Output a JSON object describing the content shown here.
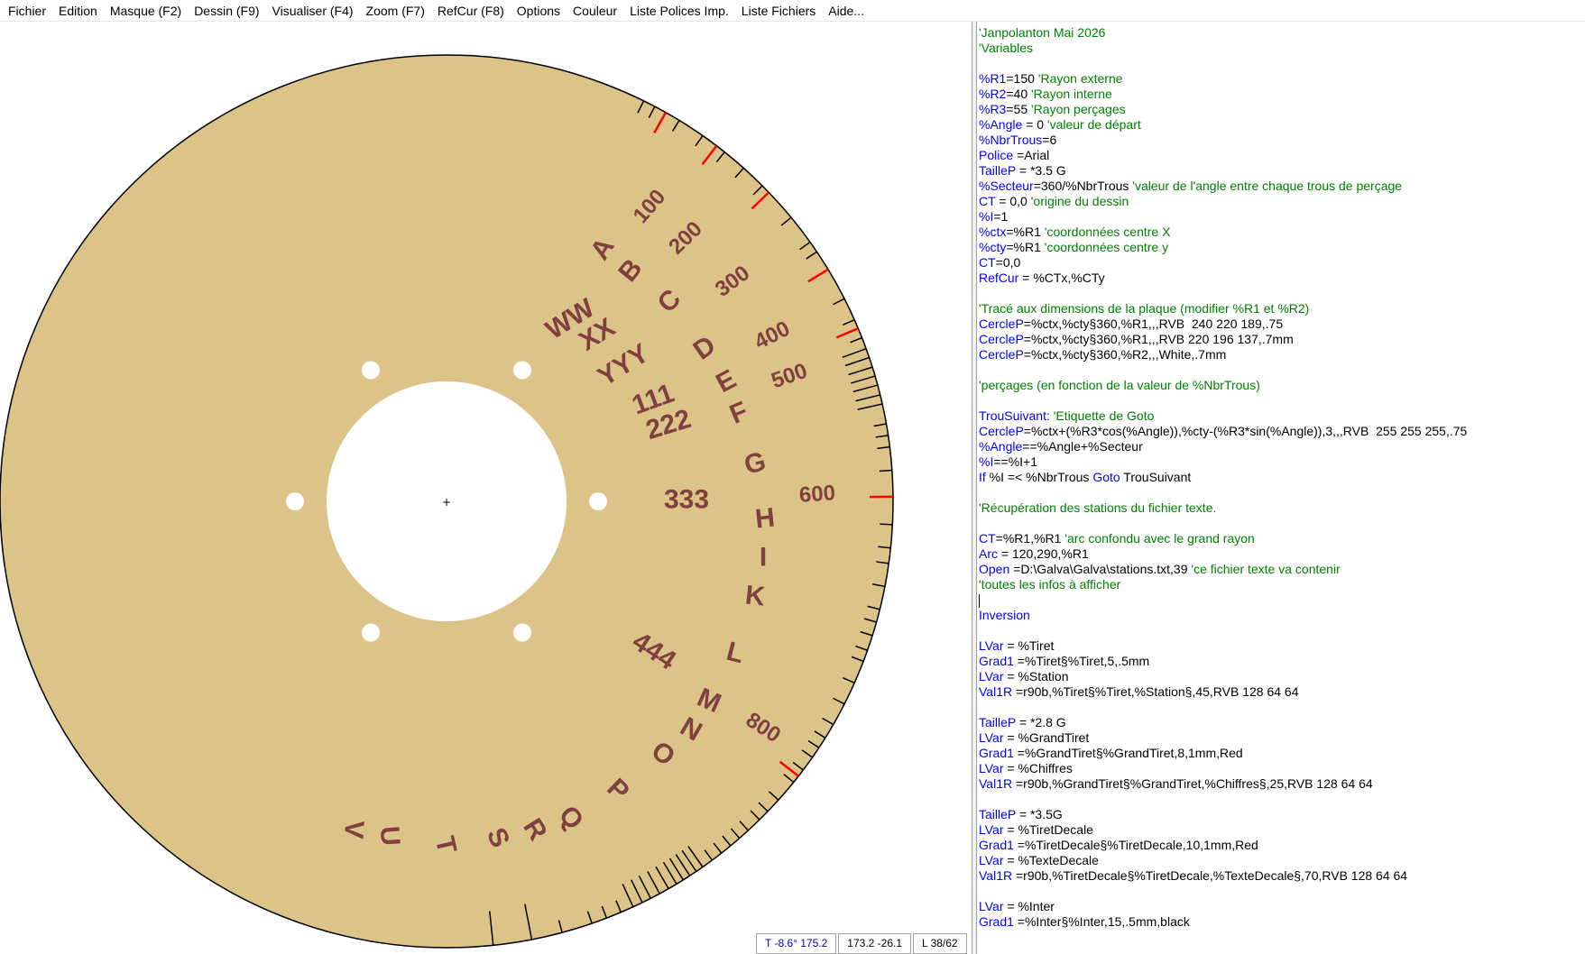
{
  "menu": [
    {
      "id": "fichier",
      "label": "Fichier"
    },
    {
      "id": "edition",
      "label": "Edition"
    },
    {
      "id": "masque",
      "label": "Masque (F2)"
    },
    {
      "id": "dessin",
      "label": "Dessin (F9)"
    },
    {
      "id": "visualiser",
      "label": "Visualiser (F4)"
    },
    {
      "id": "zoom",
      "label": "Zoom (F7)"
    },
    {
      "id": "refcur",
      "label": "RefCur (F8)"
    },
    {
      "id": "options",
      "label": "Options"
    },
    {
      "id": "couleur",
      "label": "Couleur"
    },
    {
      "id": "liste-polices",
      "label": "Liste Polices Imp."
    },
    {
      "id": "liste-fichiers",
      "label": "Liste Fichiers"
    },
    {
      "id": "aide",
      "label": "Aide..."
    }
  ],
  "colors": {
    "plate_fill": "#DCC489",
    "plate_border": "#000000",
    "label_text": "#804040",
    "tick": "#000000",
    "tick_accent": "#ff0000",
    "holes": "#ffffff",
    "code_keyword": "#0000ff",
    "code_comment": "#008000",
    "code_text": "#000000"
  },
  "drawing": {
    "letters": [
      "A",
      "B",
      "C",
      "D",
      "E",
      "F",
      "G",
      "H",
      "I",
      "K",
      "L",
      "M",
      "N",
      "O",
      "P",
      "Q",
      "R",
      "S",
      "T",
      "U",
      "V"
    ],
    "inner_labels": [
      "WW",
      "XX",
      "YYY",
      "111",
      "222",
      "333",
      "444"
    ],
    "scale_numbers": [
      "100",
      "200",
      "300",
      "400",
      "500",
      "600",
      "800"
    ],
    "center_mark": "+"
  },
  "editor": {
    "lines": [
      [
        {
          "k": "cm",
          "t": "'Janpolanton Mai 2026"
        }
      ],
      [
        {
          "k": "cm",
          "t": "'Variables"
        }
      ],
      [],
      [
        {
          "k": "kw",
          "t": "%R1"
        },
        {
          "k": "tx",
          "t": "=150 "
        },
        {
          "k": "cm",
          "t": "'Rayon externe"
        }
      ],
      [
        {
          "k": "kw",
          "t": "%R2"
        },
        {
          "k": "tx",
          "t": "=40 "
        },
        {
          "k": "cm",
          "t": "'Rayon interne"
        }
      ],
      [
        {
          "k": "kw",
          "t": "%R3"
        },
        {
          "k": "tx",
          "t": "=55 "
        },
        {
          "k": "cm",
          "t": "'Rayon perçages"
        }
      ],
      [
        {
          "k": "kw",
          "t": "%Angle"
        },
        {
          "k": "tx",
          "t": " = 0 "
        },
        {
          "k": "cm",
          "t": "'valeur de départ"
        }
      ],
      [
        {
          "k": "kw",
          "t": "%NbrTrous"
        },
        {
          "k": "tx",
          "t": "=6"
        }
      ],
      [
        {
          "k": "kw",
          "t": "Police"
        },
        {
          "k": "tx",
          "t": " =Arial"
        }
      ],
      [
        {
          "k": "kw",
          "t": "TailleP"
        },
        {
          "k": "tx",
          "t": " = *3.5 G"
        }
      ],
      [
        {
          "k": "kw",
          "t": "%Secteur"
        },
        {
          "k": "tx",
          "t": "=360/%NbrTrous "
        },
        {
          "k": "cm",
          "t": "'valeur de l'angle entre chaque trous de perçage"
        }
      ],
      [
        {
          "k": "kw",
          "t": "CT"
        },
        {
          "k": "tx",
          "t": " = 0,0 "
        },
        {
          "k": "cm",
          "t": "'origine du dessin"
        }
      ],
      [
        {
          "k": "kw",
          "t": "%I"
        },
        {
          "k": "tx",
          "t": "=1"
        }
      ],
      [
        {
          "k": "kw",
          "t": "%ctx"
        },
        {
          "k": "tx",
          "t": "=%R1 "
        },
        {
          "k": "cm",
          "t": "'coordonnées centre X"
        }
      ],
      [
        {
          "k": "kw",
          "t": "%cty"
        },
        {
          "k": "tx",
          "t": "=%R1 "
        },
        {
          "k": "cm",
          "t": "'coordonnées centre y"
        }
      ],
      [
        {
          "k": "kw",
          "t": "CT"
        },
        {
          "k": "tx",
          "t": "=0,0"
        }
      ],
      [
        {
          "k": "kw",
          "t": "RefCur"
        },
        {
          "k": "tx",
          "t": " = %CTx,%CTy"
        }
      ],
      [],
      [
        {
          "k": "cm",
          "t": "'Tracé aux dimensions de la plaque (modifier %R1 et %R2)"
        }
      ],
      [
        {
          "k": "kw",
          "t": "CercleP"
        },
        {
          "k": "tx",
          "t": "=%ctx,%cty§360,%R1,,,RVB  240 220 189,.75"
        }
      ],
      [
        {
          "k": "kw",
          "t": "CercleP"
        },
        {
          "k": "tx",
          "t": "=%ctx,%cty§360,%R1,,,RVB 220 196 137,.7mm"
        }
      ],
      [
        {
          "k": "kw",
          "t": "CercleP"
        },
        {
          "k": "tx",
          "t": "=%ctx,%cty§360,%R2,,,White,.7mm"
        }
      ],
      [],
      [
        {
          "k": "cm",
          "t": "'perçages (en fonction de la valeur de %NbrTrous)"
        }
      ],
      [],
      [
        {
          "k": "kw",
          "t": "TrouSuivant:"
        },
        {
          "k": "tx",
          "t": " "
        },
        {
          "k": "cm",
          "t": "'Etiquette de Goto"
        }
      ],
      [
        {
          "k": "kw",
          "t": "CercleP"
        },
        {
          "k": "tx",
          "t": "=%ctx+(%R3*cos(%Angle)),%cty-(%R3*sin(%Angle)),3,,,RVB  255 255 255,.75"
        }
      ],
      [
        {
          "k": "kw",
          "t": "%Angle"
        },
        {
          "k": "tx",
          "t": "==%Angle+%Secteur"
        }
      ],
      [
        {
          "k": "kw",
          "t": "%I"
        },
        {
          "k": "tx",
          "t": "==%I+1"
        }
      ],
      [
        {
          "k": "kw",
          "t": "If"
        },
        {
          "k": "tx",
          "t": " %I =< %NbrTrous "
        },
        {
          "k": "kw",
          "t": "Goto"
        },
        {
          "k": "tx",
          "t": " TrouSuivant"
        }
      ],
      [],
      [
        {
          "k": "cm",
          "t": "'Récupération des stations du fichier texte."
        }
      ],
      [],
      [
        {
          "k": "kw",
          "t": "CT"
        },
        {
          "k": "tx",
          "t": "=%R1,%R1 "
        },
        {
          "k": "cm",
          "t": "'arc confondu avec le grand rayon"
        }
      ],
      [
        {
          "k": "kw",
          "t": "Arc"
        },
        {
          "k": "tx",
          "t": " = 120,290,%R1"
        }
      ],
      [
        {
          "k": "kw",
          "t": "Open"
        },
        {
          "k": "tx",
          "t": " =D:\\Galva\\Galva\\stations.txt,39 "
        },
        {
          "k": "cm",
          "t": "'ce fichier texte va contenir"
        }
      ],
      [
        {
          "k": "cm",
          "t": "'toutes les infos à afficher"
        }
      ],
      [
        {
          "k": "caret",
          "t": ""
        }
      ],
      [
        {
          "k": "kw",
          "t": "Inversion"
        }
      ],
      [],
      [
        {
          "k": "kw",
          "t": "LVar"
        },
        {
          "k": "tx",
          "t": " = %Tiret"
        }
      ],
      [
        {
          "k": "kw",
          "t": "Grad1"
        },
        {
          "k": "tx",
          "t": " =%Tiret§%Tiret,5,.5mm"
        }
      ],
      [
        {
          "k": "kw",
          "t": "LVar"
        },
        {
          "k": "tx",
          "t": " = %Station"
        }
      ],
      [
        {
          "k": "kw",
          "t": "Val1R"
        },
        {
          "k": "tx",
          "t": " =r90b,%Tiret§%Tiret,%Station§,45,RVB 128 64 64"
        }
      ],
      [],
      [
        {
          "k": "kw",
          "t": "TailleP"
        },
        {
          "k": "tx",
          "t": " = *2.8 G"
        }
      ],
      [
        {
          "k": "kw",
          "t": "LVar"
        },
        {
          "k": "tx",
          "t": " = %GrandTiret"
        }
      ],
      [
        {
          "k": "kw",
          "t": "Grad1"
        },
        {
          "k": "tx",
          "t": " =%GrandTiret§%GrandTiret,8,1mm,Red"
        }
      ],
      [
        {
          "k": "kw",
          "t": "LVar"
        },
        {
          "k": "tx",
          "t": " = %Chiffres"
        }
      ],
      [
        {
          "k": "kw",
          "t": "Val1R"
        },
        {
          "k": "tx",
          "t": " =r90b,%GrandTiret§%GrandTiret,%Chiffres§,25,RVB 128 64 64"
        }
      ],
      [],
      [
        {
          "k": "kw",
          "t": "TailleP"
        },
        {
          "k": "tx",
          "t": " = *3.5G"
        }
      ],
      [
        {
          "k": "kw",
          "t": "LVar"
        },
        {
          "k": "tx",
          "t": " = %TiretDecale"
        }
      ],
      [
        {
          "k": "kw",
          "t": "Grad1"
        },
        {
          "k": "tx",
          "t": " =%TiretDecale§%TiretDecale,10,1mm,Red"
        }
      ],
      [
        {
          "k": "kw",
          "t": "LVar"
        },
        {
          "k": "tx",
          "t": " = %TexteDecale"
        }
      ],
      [
        {
          "k": "kw",
          "t": "Val1R"
        },
        {
          "k": "tx",
          "t": " =r90b,%TiretDecale§%TiretDecale,%TexteDecale§,70,RVB 128 64 64"
        }
      ],
      [],
      [
        {
          "k": "kw",
          "t": "LVar"
        },
        {
          "k": "tx",
          "t": " = %Inter"
        }
      ],
      [
        {
          "k": "kw",
          "t": "Grad1"
        },
        {
          "k": "tx",
          "t": " =%Inter§%Inter,15,.5mm,black"
        }
      ]
    ]
  },
  "status": {
    "angle": "T -8.6° 175.2",
    "coords": "173.2  -26.1",
    "line": "L 38/62"
  }
}
